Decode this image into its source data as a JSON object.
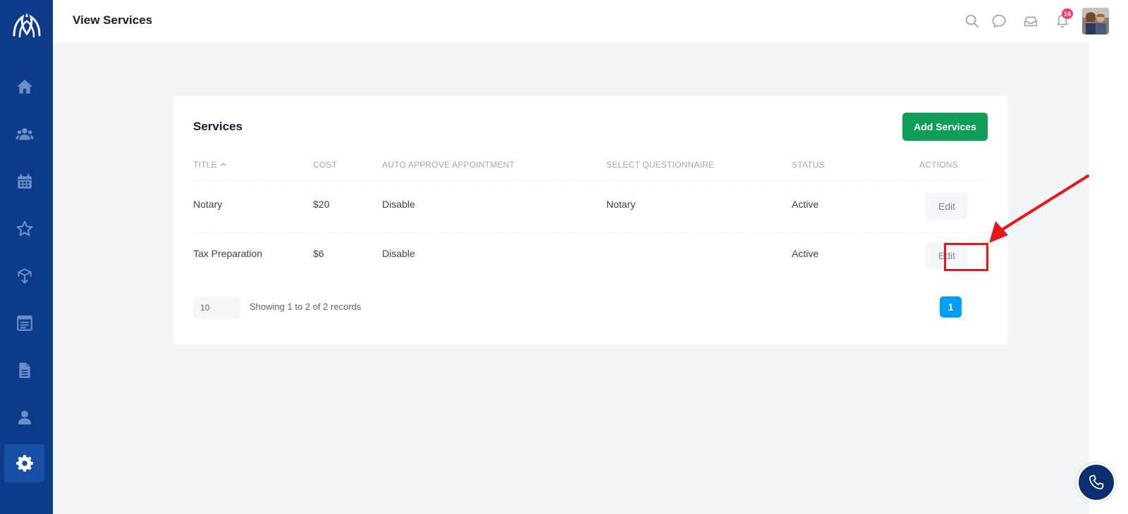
{
  "header": {
    "title": "View Services",
    "notification_count": "14"
  },
  "sidebar": {
    "items": [
      {
        "icon": "home-icon"
      },
      {
        "icon": "users-icon"
      },
      {
        "icon": "calendar-icon"
      },
      {
        "icon": "star-icon"
      },
      {
        "icon": "box-icon"
      },
      {
        "icon": "list-icon"
      },
      {
        "icon": "document-icon"
      },
      {
        "icon": "user-icon"
      },
      {
        "icon": "gear-icon",
        "active": true
      }
    ]
  },
  "card": {
    "title": "Services",
    "add_button": "Add Services",
    "columns": [
      "TITLE",
      "COST",
      "AUTO APPROVE APPOINTMENT",
      "SELECT QUESTIONNAIRE",
      "STATUS",
      "ACTIONS"
    ],
    "rows": [
      {
        "title": "Notary",
        "cost": "$20",
        "auto_approve": "Disable",
        "questionnaire": "Notary",
        "status": "Active",
        "action": "Edit"
      },
      {
        "title": "Tax Preparation",
        "cost": "$6",
        "auto_approve": "Disable",
        "questionnaire": "",
        "status": "Active",
        "action": "Edit"
      }
    ],
    "page_size": "10",
    "records_text": "Showing 1 to 2 of 2 records",
    "current_page": "1"
  },
  "colors": {
    "sidebar": "#0c3b8a",
    "primary_green": "#0f9d58",
    "page_blue": "#009ef7",
    "annotation_red": "#e8161b"
  }
}
